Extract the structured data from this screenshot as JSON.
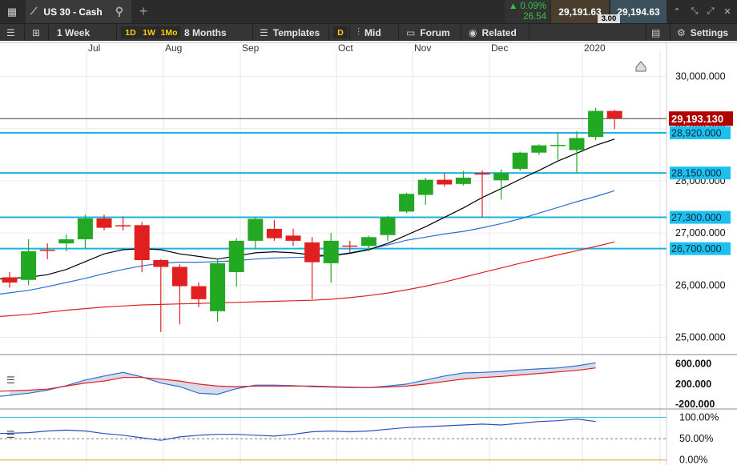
{
  "topbar": {
    "instrument": "US 30 - Cash",
    "add_tab": "+",
    "change_percent": "▲ 0.09%",
    "change_points": "26.54",
    "bid": "29,191.63",
    "ask": "29,194.63",
    "spread": "3.00"
  },
  "toolbar": {
    "interval": "1 Week",
    "quick_intervals": [
      "1D",
      "1W",
      "1Mo"
    ],
    "range": "8 Months",
    "templates": "Templates",
    "d_button": "D",
    "price_type": "Mid",
    "forum": "Forum",
    "related": "Related",
    "settings": "Settings"
  },
  "colors": {
    "up": "#22a822",
    "down": "#e02020",
    "level_line": "#19b4e0",
    "level_tag": "#1cc0ef",
    "sma_short": "#000000",
    "sma_mid": "#2b6fd6",
    "sma_long": "#e02020",
    "current_tag": "#b00000"
  },
  "chart_data": {
    "type": "candlestick",
    "x_labels": [
      "Jul",
      "Aug",
      "Sep",
      "Oct",
      "Nov",
      "Dec",
      "2020"
    ],
    "y_ticks": [
      "30,000.000",
      "29,000.000",
      "28,000.000",
      "27,000.000",
      "26,000.000",
      "25,000.000"
    ],
    "y_tick_values": [
      30000,
      29000,
      28000,
      27000,
      26000,
      25000
    ],
    "ylim": [
      24700,
      30500
    ],
    "current_price": 29193.13,
    "current_price_label": "29,193.130",
    "levels": [
      {
        "value": 28920,
        "label": "28,920.000"
      },
      {
        "value": 28150,
        "label": "28,150.000"
      },
      {
        "value": 27300,
        "label": "27,300.000"
      },
      {
        "value": 26700,
        "label": "26,700.000"
      }
    ],
    "candles": [
      {
        "o": 26150,
        "h": 26250,
        "l": 25950,
        "c": 26050
      },
      {
        "o": 26100,
        "h": 26880,
        "l": 26000,
        "c": 26650
      },
      {
        "o": 26680,
        "h": 26800,
        "l": 26500,
        "c": 26670
      },
      {
        "o": 26800,
        "h": 26970,
        "l": 26650,
        "c": 26880
      },
      {
        "o": 26880,
        "h": 27350,
        "l": 26700,
        "c": 27280
      },
      {
        "o": 27280,
        "h": 27350,
        "l": 27050,
        "c": 27100
      },
      {
        "o": 27150,
        "h": 27320,
        "l": 27050,
        "c": 27140
      },
      {
        "o": 27150,
        "h": 27210,
        "l": 26250,
        "c": 26480
      },
      {
        "o": 26480,
        "h": 26500,
        "l": 25100,
        "c": 26350
      },
      {
        "o": 26350,
        "h": 26400,
        "l": 25250,
        "c": 25980
      },
      {
        "o": 25980,
        "h": 26050,
        "l": 25580,
        "c": 25730
      },
      {
        "o": 25500,
        "h": 26500,
        "l": 25300,
        "c": 26420
      },
      {
        "o": 26250,
        "h": 26900,
        "l": 25970,
        "c": 26850
      },
      {
        "o": 26850,
        "h": 27300,
        "l": 26700,
        "c": 27270
      },
      {
        "o": 27080,
        "h": 27250,
        "l": 26850,
        "c": 26900
      },
      {
        "o": 26950,
        "h": 27080,
        "l": 26750,
        "c": 26850
      },
      {
        "o": 26820,
        "h": 26920,
        "l": 25730,
        "c": 26440
      },
      {
        "o": 26420,
        "h": 27000,
        "l": 26050,
        "c": 26850
      },
      {
        "o": 26760,
        "h": 26850,
        "l": 26630,
        "c": 26750
      },
      {
        "o": 26750,
        "h": 26950,
        "l": 26650,
        "c": 26920
      },
      {
        "o": 26960,
        "h": 27330,
        "l": 26850,
        "c": 27300
      },
      {
        "o": 27410,
        "h": 27770,
        "l": 27380,
        "c": 27750
      },
      {
        "o": 27730,
        "h": 28060,
        "l": 27540,
        "c": 28020
      },
      {
        "o": 28020,
        "h": 28150,
        "l": 27890,
        "c": 27930
      },
      {
        "o": 27940,
        "h": 28190,
        "l": 27910,
        "c": 28060
      },
      {
        "o": 28150,
        "h": 28200,
        "l": 27300,
        "c": 28120
      },
      {
        "o": 28010,
        "h": 28220,
        "l": 27640,
        "c": 28150
      },
      {
        "o": 28230,
        "h": 28560,
        "l": 28190,
        "c": 28540
      },
      {
        "o": 28540,
        "h": 28700,
        "l": 28500,
        "c": 28680
      },
      {
        "o": 28690,
        "h": 28920,
        "l": 28400,
        "c": 28690
      },
      {
        "o": 28590,
        "h": 28950,
        "l": 28150,
        "c": 28820
      },
      {
        "o": 28840,
        "h": 29400,
        "l": 28780,
        "c": 29340
      },
      {
        "o": 29340,
        "h": 29360,
        "l": 28990,
        "c": 29193
      }
    ],
    "sma_short": [
      26120,
      26150,
      26200,
      26300,
      26450,
      26600,
      26680,
      26700,
      26680,
      26600,
      26550,
      26500,
      26560,
      26620,
      26640,
      26620,
      26580,
      26560,
      26610,
      26680,
      26800,
      26960,
      27120,
      27300,
      27480,
      27680,
      27850,
      28030,
      28200,
      28380,
      28530,
      28680,
      28800
    ],
    "sma_mid": [
      25830,
      25900,
      25970,
      26050,
      26130,
      26220,
      26300,
      26370,
      26420,
      26440,
      26440,
      26450,
      26470,
      26500,
      26520,
      26530,
      26540,
      26570,
      26620,
      26690,
      26770,
      26860,
      26920,
      26980,
      27030,
      27100,
      27180,
      27270,
      27380,
      27490,
      27600,
      27700,
      27810
    ],
    "sma_long": [
      25400,
      25440,
      25480,
      25520,
      25550,
      25580,
      25600,
      25620,
      25630,
      25640,
      25650,
      25660,
      25670,
      25680,
      25690,
      25700,
      25710,
      25730,
      25760,
      25800,
      25850,
      25910,
      25980,
      26060,
      26150,
      26240,
      26330,
      26420,
      26500,
      26580,
      26660,
      26740,
      26830
    ],
    "macd": {
      "y_ticks": [
        "600.000",
        "200.000",
        "-200.000"
      ],
      "y_tick_values": [
        600,
        200,
        -200
      ],
      "ylim": [
        -260,
        720
      ],
      "macd": [
        -40,
        20,
        80,
        170,
        280,
        360,
        430,
        340,
        220,
        150,
        20,
        0,
        110,
        180,
        180,
        170,
        150,
        140,
        130,
        130,
        160,
        200,
        280,
        360,
        420,
        430,
        450,
        480,
        500,
        520,
        560,
        620
      ],
      "signal": [
        60,
        80,
        100,
        160,
        220,
        260,
        330,
        330,
        300,
        260,
        200,
        160,
        150,
        160,
        160,
        160,
        160,
        150,
        140,
        130,
        140,
        160,
        200,
        250,
        300,
        330,
        350,
        380,
        410,
        440,
        470,
        520
      ]
    },
    "stoch": {
      "y_ticks": [
        "100.00%",
        "50.00%",
        "0.00%"
      ],
      "y_tick_values": [
        100,
        50,
        0
      ],
      "ylim": [
        -8,
        112
      ],
      "values": [
        62,
        64,
        68,
        70,
        68,
        62,
        58,
        52,
        46,
        54,
        58,
        60,
        60,
        58,
        56,
        60,
        66,
        68,
        66,
        68,
        72,
        76,
        78,
        80,
        82,
        84,
        82,
        86,
        90,
        92,
        96,
        90
      ]
    }
  }
}
